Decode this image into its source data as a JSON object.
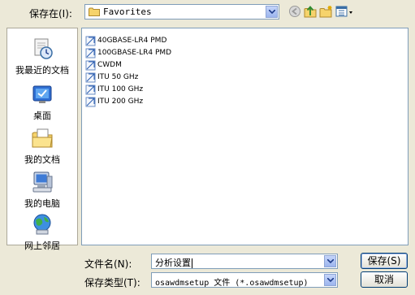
{
  "toolbar": {
    "save_in_label": "保存在(I):",
    "location_value": "Favorites",
    "icons": [
      "back-icon",
      "up-folder-icon",
      "new-folder-icon",
      "view-menu-icon"
    ]
  },
  "places": [
    {
      "label": "我最近的文档",
      "icon": "recent-documents-icon"
    },
    {
      "label": "桌面",
      "icon": "desktop-icon"
    },
    {
      "label": "我的文档",
      "icon": "my-documents-icon"
    },
    {
      "label": "我的电脑",
      "icon": "my-computer-icon"
    },
    {
      "label": "网上邻居",
      "icon": "network-places-icon"
    }
  ],
  "files": [
    "40GBASE-LR4 PMD",
    "100GBASE-LR4 PMD",
    "CWDM",
    "ITU 50 GHz",
    "ITU 100 GHz",
    "ITU 200 GHz"
  ],
  "filename": {
    "label": "文件名(N):",
    "value": "分析设置"
  },
  "filetype": {
    "label": "保存类型(T):",
    "value": "osawdmsetup 文件 (*.osawdmsetup)"
  },
  "buttons": {
    "save": "保存(S)",
    "cancel": "取消"
  },
  "colors": {
    "dialog_bg": "#ECE9D8",
    "field_border": "#7F9DB9",
    "button_border": "#003C74"
  }
}
